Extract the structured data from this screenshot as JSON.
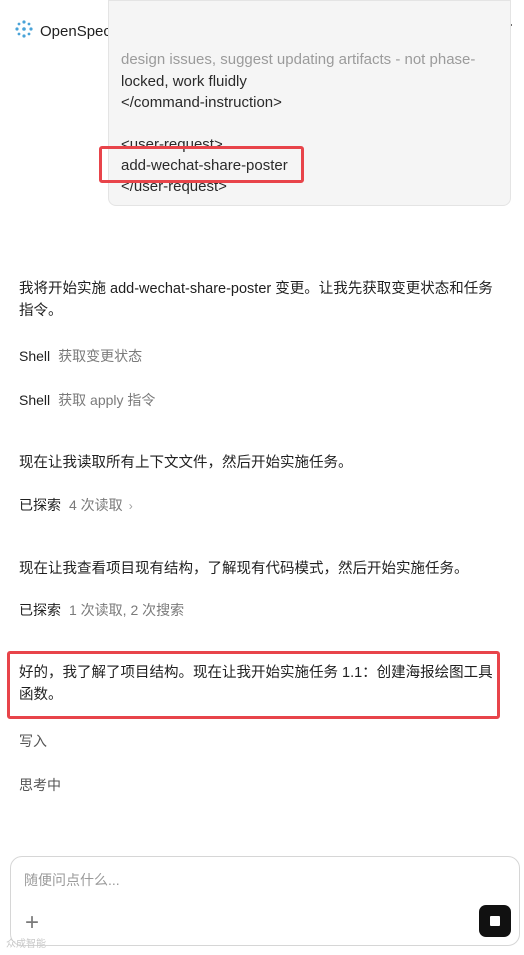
{
  "header": {
    "title": "OpenSpec 与 OPSX 工作流程详解"
  },
  "codeblock": {
    "lines": [
      "design issues, suggest updating artifacts - not phase-",
      "locked, work fluidly",
      "</command-instruction>",
      "<user-request>",
      "add-wechat-share-poster",
      "</user-request>"
    ]
  },
  "messages": {
    "intro": "我将开始实施 add-wechat-share-poster 变更。让我先获取变更状态和任务指令。",
    "shell1": {
      "label": "Shell",
      "detail": "获取变更状态"
    },
    "shell2": {
      "label": "Shell",
      "detail": "获取 apply 指令"
    },
    "read_ctx": "现在让我读取所有上下文文件，然后开始实施任务。",
    "explored1": {
      "label": "已探索",
      "detail": "4 次读取"
    },
    "check_struct": "现在让我查看项目现有结构，了解现有代码模式，然后开始实施任务。",
    "explored2": {
      "label": "已探索",
      "detail": "1 次读取, 2 次搜索"
    },
    "highlighted": "好的，我了解了项目结构。现在让我开始实施任务 1.1：创建海报绘图工具函数。",
    "writing": "写入",
    "thinking": "思考中"
  },
  "input": {
    "placeholder": "随便问点什么..."
  },
  "watermark": "众成智能"
}
